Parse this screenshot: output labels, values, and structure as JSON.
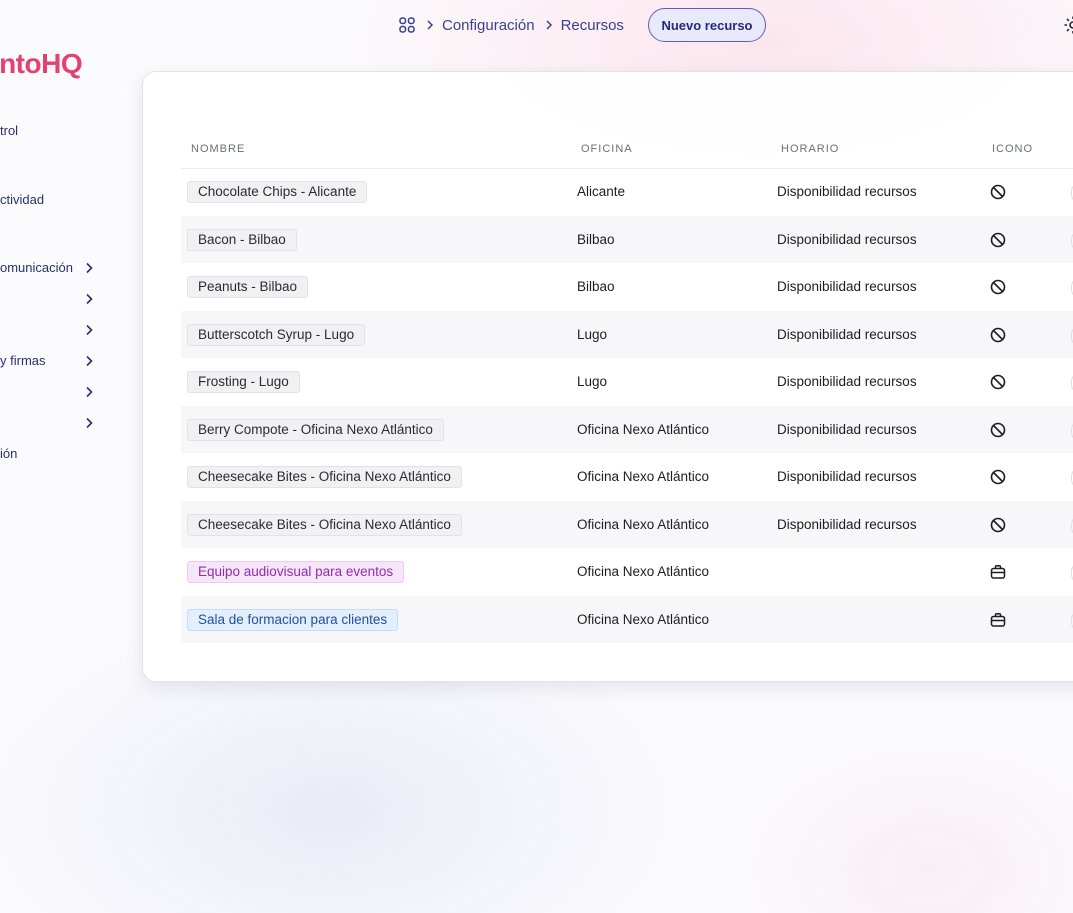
{
  "breadcrumb": {
    "items": [
      "Configuración",
      "Recursos"
    ],
    "new_button": "Nuevo recurso"
  },
  "sidebar": {
    "logo": {
      "part1": "ento",
      "part2": "HQ"
    },
    "items": [
      {
        "label": "trol",
        "chevron": false
      },
      {
        "label": "ctividad",
        "chevron": false
      },
      {
        "label": "omunicación",
        "chevron": true
      },
      {
        "label": "",
        "chevron": true
      },
      {
        "label": "",
        "chevron": true
      },
      {
        "label": "y firmas",
        "chevron": true
      },
      {
        "label": "",
        "chevron": true
      },
      {
        "label": "",
        "chevron": true
      },
      {
        "label": "ión",
        "chevron": false
      }
    ]
  },
  "table": {
    "headers": {
      "name": "NOMBRE",
      "office": "OFICINA",
      "schedule": "HORARIO",
      "icon": "ICONO"
    },
    "rows": [
      {
        "name": "Chocolate Chips - Alicante",
        "office": "Alicante",
        "schedule": "Disponibilidad recursos",
        "icon": "block-icon",
        "tag": "gray"
      },
      {
        "name": "Bacon - Bilbao",
        "office": "Bilbao",
        "schedule": "Disponibilidad recursos",
        "icon": "block-icon",
        "tag": "gray"
      },
      {
        "name": "Peanuts - Bilbao",
        "office": "Bilbao",
        "schedule": "Disponibilidad recursos",
        "icon": "block-icon",
        "tag": "gray"
      },
      {
        "name": "Butterscotch Syrup - Lugo",
        "office": "Lugo",
        "schedule": "Disponibilidad recursos",
        "icon": "block-icon",
        "tag": "gray"
      },
      {
        "name": "Frosting - Lugo",
        "office": "Lugo",
        "schedule": "Disponibilidad recursos",
        "icon": "block-icon",
        "tag": "gray"
      },
      {
        "name": "Berry Compote - Oficina Nexo Atlántico",
        "office": "Oficina Nexo Atlántico",
        "schedule": "Disponibilidad recursos",
        "icon": "block-icon",
        "tag": "gray"
      },
      {
        "name": "Cheesecake Bites - Oficina Nexo Atlántico",
        "office": "Oficina Nexo Atlántico",
        "schedule": "Disponibilidad recursos",
        "icon": "block-icon",
        "tag": "gray"
      },
      {
        "name": "Cheesecake Bites - Oficina Nexo Atlántico",
        "office": "Oficina Nexo Atlántico",
        "schedule": "Disponibilidad recursos",
        "icon": "block-icon",
        "tag": "gray"
      },
      {
        "name": "Equipo audiovisual para eventos",
        "office": "Oficina Nexo Atlántico",
        "schedule": "",
        "icon": "briefcase-icon",
        "tag": "purple"
      },
      {
        "name": "Sala de formacion para clientes",
        "office": "Oficina Nexo Atlántico",
        "schedule": "",
        "icon": "briefcase-icon",
        "tag": "blue"
      }
    ]
  },
  "colors": {
    "accent": "#3b3f8f",
    "logo": "#e3426e",
    "tag_purple": "#8f2ea6",
    "tag_blue": "#234f9c"
  }
}
